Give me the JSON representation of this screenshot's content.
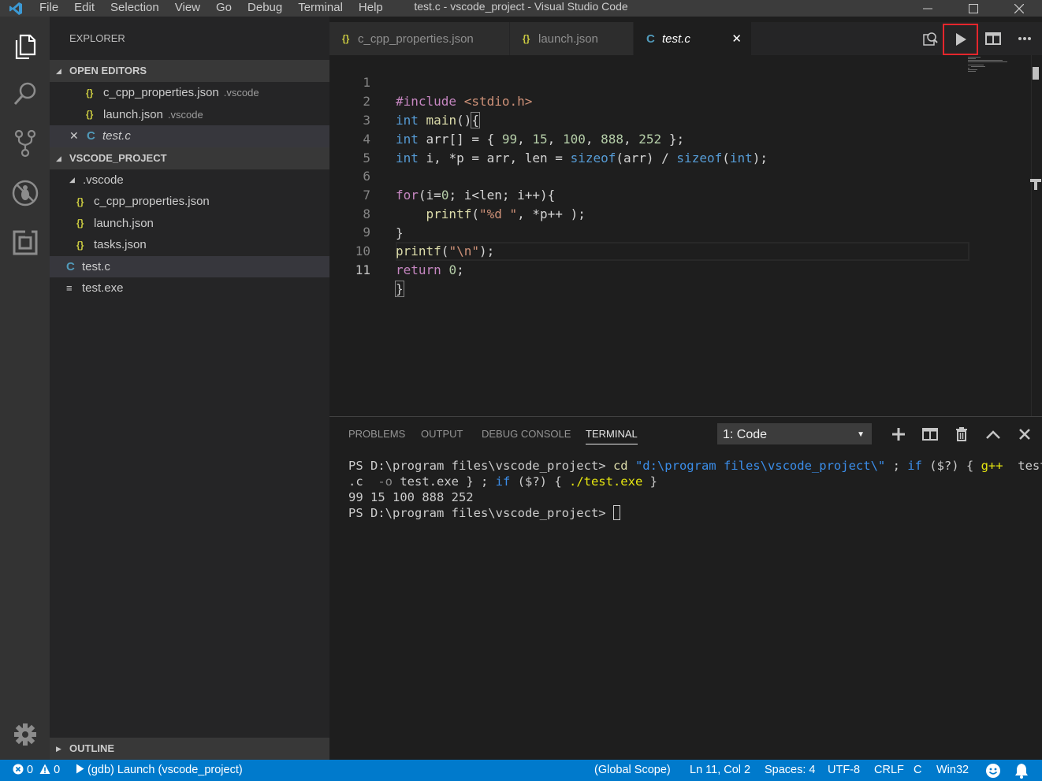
{
  "window": {
    "title": "test.c - vscode_project - Visual Studio Code",
    "menu": [
      "File",
      "Edit",
      "Selection",
      "View",
      "Go",
      "Debug",
      "Terminal",
      "Help"
    ]
  },
  "explorer": {
    "title": "EXPLORER",
    "open_editors": {
      "header": "OPEN EDITORS",
      "items": [
        {
          "name": "c_cpp_properties.json",
          "desc": ".vscode"
        },
        {
          "name": "launch.json",
          "desc": ".vscode"
        },
        {
          "name": "test.c",
          "desc": ""
        }
      ]
    },
    "project": {
      "header": "VSCODE_PROJECT",
      "folder": ".vscode",
      "folder_files": [
        "c_cpp_properties.json",
        "launch.json",
        "tasks.json"
      ],
      "files": [
        "test.c",
        "test.exe"
      ]
    },
    "outline_header": "OUTLINE"
  },
  "tabs": [
    {
      "label": "c_cpp_properties.json"
    },
    {
      "label": "launch.json"
    },
    {
      "label": "test.c"
    }
  ],
  "editor": {
    "line_numbers": [
      "1",
      "2",
      "3",
      "4",
      "5",
      "6",
      "7",
      "8",
      "9",
      "10",
      "11"
    ],
    "current_line": "11"
  },
  "panel": {
    "tabs": [
      "PROBLEMS",
      "OUTPUT",
      "DEBUG CONSOLE",
      "TERMINAL"
    ],
    "terminal_select": "1: Code",
    "terminal": {
      "prompt": "PS D:\\program files\\vscode_project> ",
      "cmd_cd": "cd",
      "cd_path": "\"d:\\program files\\vscode_project\\\"",
      "sep": " ; ",
      "if_kw": "if",
      "cond": " ($?) { ",
      "gpp": "g++",
      "gpp_args_1": "  test",
      "gpp_args_2": ".c ",
      "gpp_flag": " -o",
      "gpp_out": " test.exe } ; ",
      "if_kw_2": "if",
      "cond_2": " ($?) { ",
      "run": "./test.exe",
      "tail": " }",
      "output": "99 15 100 888 252",
      "prompt_2": "PS D:\\program files\\vscode_project> "
    }
  },
  "statusbar": {
    "errors": "0",
    "warnings": "0",
    "debug_config": "(gdb) Launch (vscode_project)",
    "scope": "(Global Scope)",
    "position": "Ln 11, Col 2",
    "spaces": "Spaces: 4",
    "encoding": "UTF-8",
    "eol": "CRLF",
    "language": "C",
    "platform": "Win32"
  },
  "colors": {
    "accent": "#007acc",
    "highlight_box": "#e5262c"
  },
  "icons": {
    "activity": [
      "files-icon",
      "search-icon",
      "source-control-icon",
      "debug-icon",
      "extensions-icon",
      "settings-gear-icon"
    ],
    "editor_actions": [
      "open-preview-icon",
      "run-icon",
      "split-editor-icon",
      "more-actions-icon"
    ],
    "panel_actions": [
      "new-terminal-icon",
      "split-terminal-icon",
      "kill-terminal-icon",
      "maximize-panel-icon",
      "close-panel-icon"
    ]
  }
}
